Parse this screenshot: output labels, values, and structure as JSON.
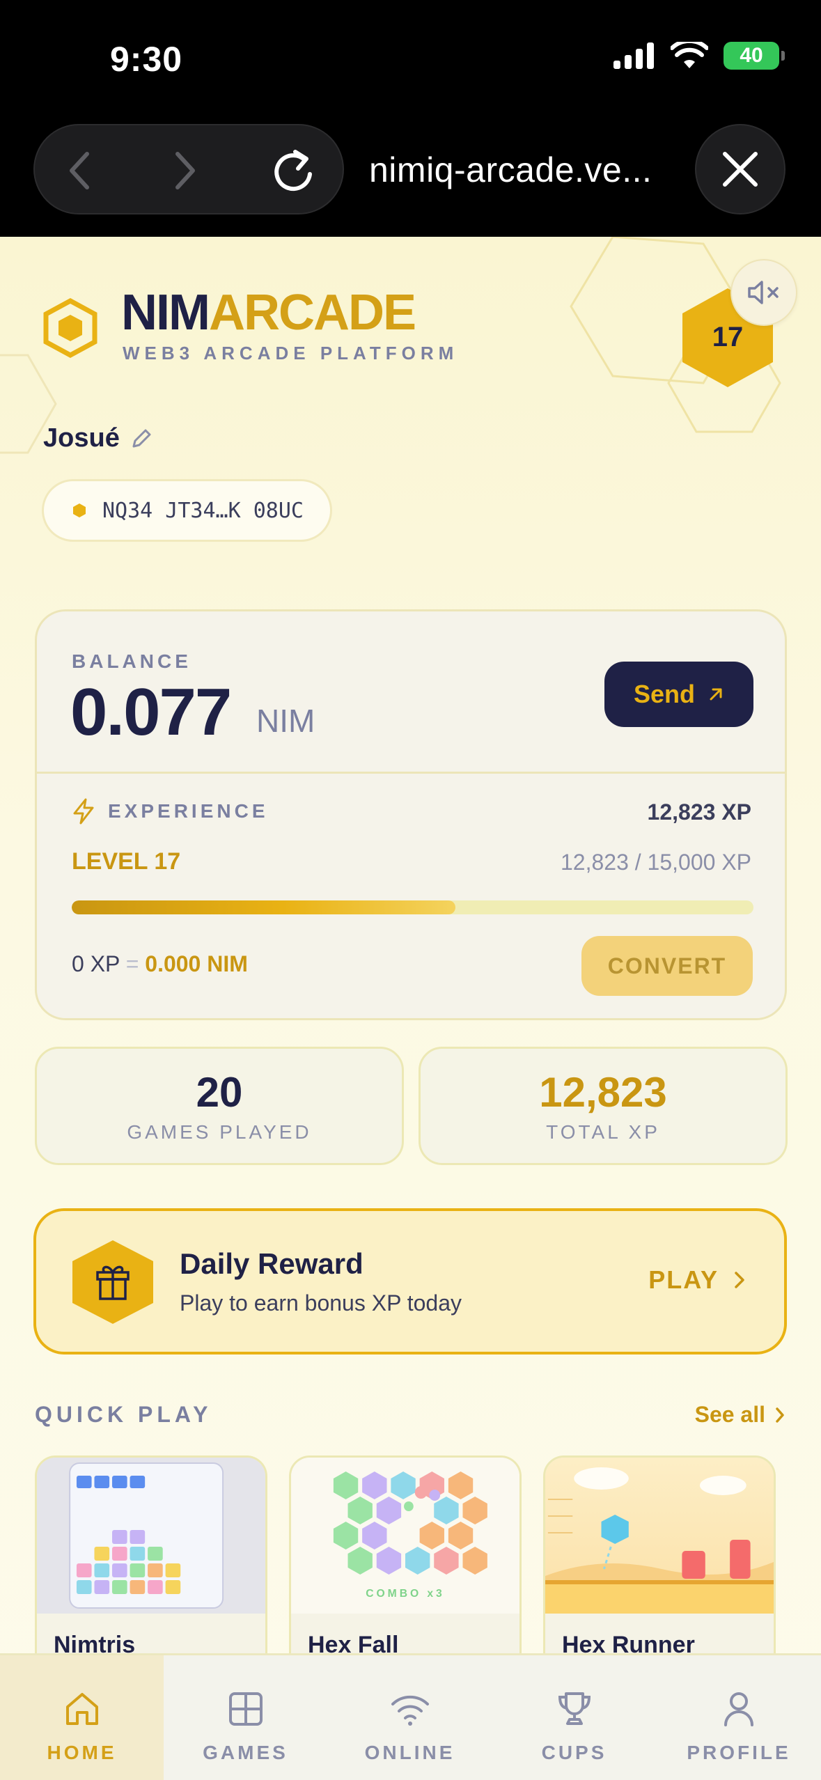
{
  "status_bar": {
    "time": "9:30",
    "battery": "40"
  },
  "browser": {
    "url": "nimiq-arcade.ve..."
  },
  "header": {
    "brand_part1": "NIM",
    "brand_part2": "ARCADE",
    "tagline": "WEB3 ARCADE PLATFORM",
    "level_badge": "17"
  },
  "user": {
    "name": "Josué",
    "address": "NQ34 JT34…K 08UC"
  },
  "balance": {
    "label": "BALANCE",
    "value": "0.077",
    "unit": "NIM",
    "send_label": "Send"
  },
  "experience": {
    "label": "EXPERIENCE",
    "total": "12,823 XP",
    "level": "LEVEL 17",
    "progress_text": "12,823 / 15,000 XP",
    "progress_fraction": 0.5625,
    "conversion_xp": "0 XP",
    "conversion_eq": "=",
    "conversion_nim": "0.000 NIM",
    "convert_label": "CONVERT"
  },
  "stats": [
    {
      "value": "20",
      "label": "GAMES PLAYED"
    },
    {
      "value": "12,823",
      "label": "TOTAL XP"
    }
  ],
  "daily_reward": {
    "title": "Daily Reward",
    "subtitle": "Play to earn bonus XP today",
    "action": "PLAY"
  },
  "quick_play": {
    "label": "QUICK PLAY",
    "see_all": "See all",
    "games": [
      {
        "title": "Nimtris"
      },
      {
        "title": "Hex Fall",
        "art_caption": "COMBO x3"
      },
      {
        "title": "Hex Runner"
      }
    ]
  },
  "tabs": [
    {
      "label": "HOME",
      "icon": "home-icon",
      "active": true
    },
    {
      "label": "GAMES",
      "icon": "grid-icon"
    },
    {
      "label": "ONLINE",
      "icon": "wifi-icon"
    },
    {
      "label": "CUPS",
      "icon": "trophy-icon"
    },
    {
      "label": "PROFILE",
      "icon": "user-icon"
    }
  ],
  "colors": {
    "navy": "#1f2146",
    "gold": "#d4a017",
    "gold_bright": "#e9b214",
    "cream": "#faf5d2"
  }
}
